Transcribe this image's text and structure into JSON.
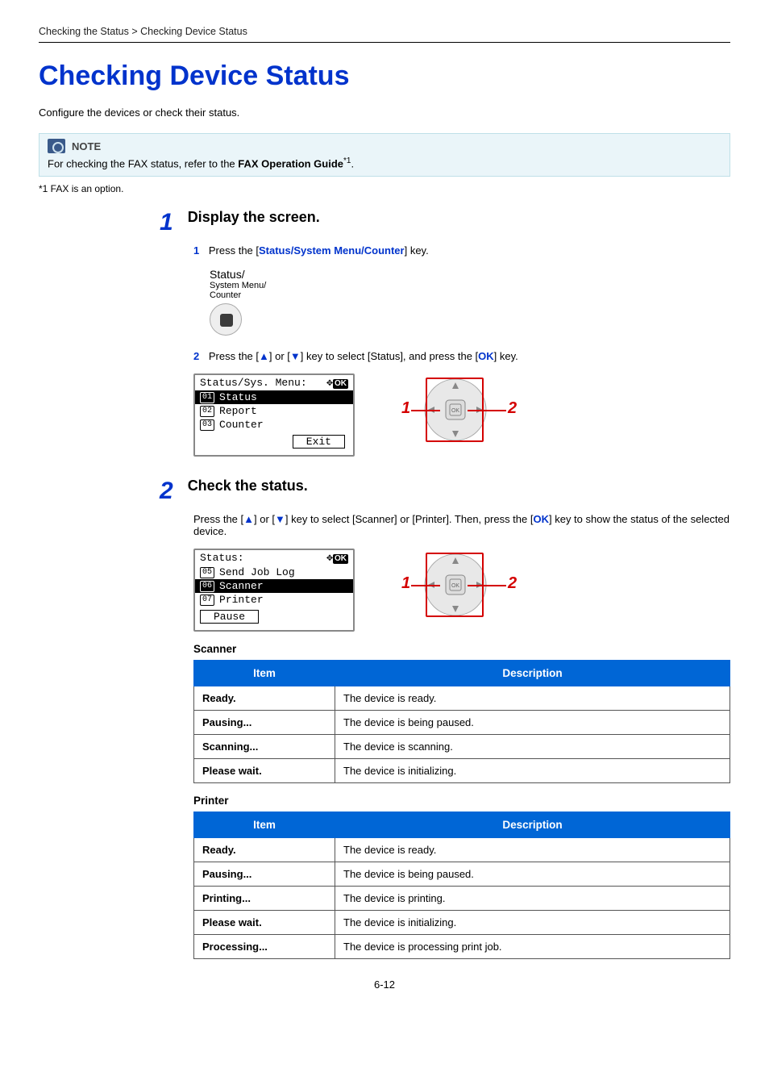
{
  "breadcrumb": "Checking the Status > Checking Device Status",
  "title": "Checking Device Status",
  "intro": "Configure the devices or check their status.",
  "note": {
    "label": "NOTE",
    "body_pre": "For checking the FAX status, refer to the ",
    "body_bold": "FAX Operation Guide",
    "body_sup": "*1",
    "body_post": "."
  },
  "footnote": "*1   FAX is an option.",
  "step1": {
    "num": "1",
    "heading": "Display the screen.",
    "sub1": {
      "num": "1",
      "pre": "Press the [",
      "key": "Status/System Menu/Counter",
      "post": "] key."
    },
    "panel_label1": "Status/",
    "panel_label2": "System Menu/",
    "panel_label3": "Counter",
    "sub2": {
      "num": "2",
      "pre": "Press the [",
      "arrow_up": "▲",
      "mid1": "] or [",
      "arrow_down": "▼",
      "mid2": "] key to select [Status], and press the [",
      "ok": "OK",
      "post": "] key."
    },
    "lcd": {
      "header": "Status/Sys. Menu:",
      "n1": "01",
      "r1": "Status",
      "n2": "02",
      "r2": "Report",
      "n3": "03",
      "r3": "Counter",
      "soft": "Exit"
    },
    "diag_l1": "1",
    "diag_l2": "2"
  },
  "step2": {
    "num": "2",
    "heading": "Check the status.",
    "body_pre": "Press the [",
    "arrow_up": "▲",
    "mid1": "] or [",
    "arrow_down": "▼",
    "mid2": "] key to select [Scanner] or [Printer]. Then, press the [",
    "ok": "OK",
    "post": "] key to show the status of the selected device.",
    "lcd": {
      "header": "Status:",
      "n1": "05",
      "r1": "Send Job Log",
      "n2": "06",
      "r2": "Scanner",
      "n3": "07",
      "r3": "Printer",
      "soft": "Pause"
    },
    "diag_l1": "1",
    "diag_l2": "2",
    "scanner": {
      "title": "Scanner",
      "header_item": "Item",
      "header_desc": "Description",
      "rows": [
        {
          "item": "Ready.",
          "desc": "The device is ready."
        },
        {
          "item": "Pausing...",
          "desc": "The device is being paused."
        },
        {
          "item": "Scanning...",
          "desc": "The device is scanning."
        },
        {
          "item": "Please wait.",
          "desc": "The device is initializing."
        }
      ]
    },
    "printer": {
      "title": "Printer",
      "header_item": "Item",
      "header_desc": "Description",
      "rows": [
        {
          "item": "Ready.",
          "desc": "The device is ready."
        },
        {
          "item": "Pausing...",
          "desc": "The device is being paused."
        },
        {
          "item": "Printing...",
          "desc": "The device is printing."
        },
        {
          "item": "Please wait.",
          "desc": "The device is initializing."
        },
        {
          "item": "Processing...",
          "desc": "The device is processing print job."
        }
      ]
    }
  },
  "page_number": "6-12"
}
